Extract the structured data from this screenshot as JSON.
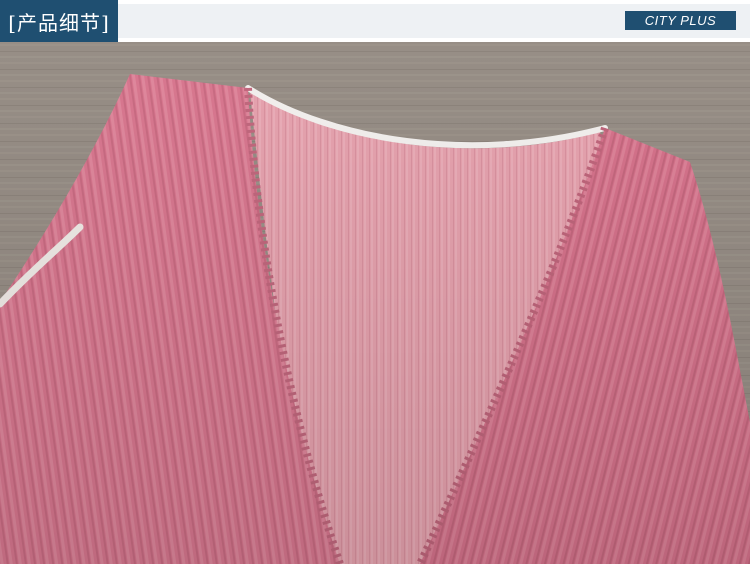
{
  "header": {
    "title": "[产品细节]",
    "brand": "CITY PLUS"
  },
  "colors": {
    "header_blue": "#1f4f71",
    "fabric_pink": "#d9788f",
    "lining_pink": "#e6a2ae",
    "wood": "#8d847b",
    "trim": "#f4f1ef"
  }
}
